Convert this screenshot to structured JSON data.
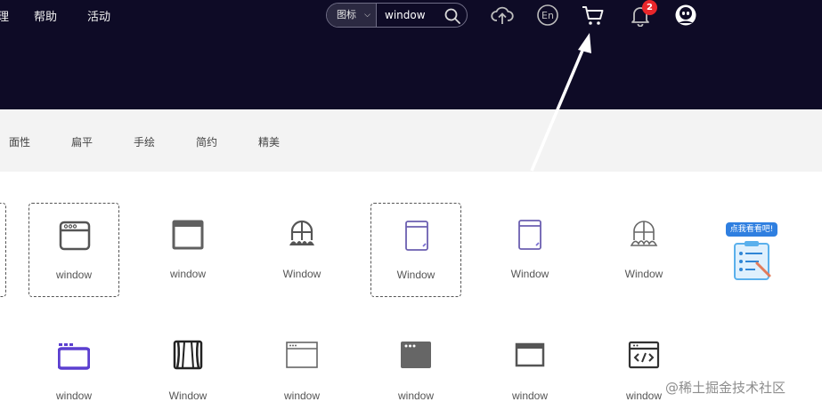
{
  "header": {
    "nav_partial": "理",
    "nav": [
      "帮助",
      "活动"
    ],
    "search": {
      "category": "图标",
      "value": "window"
    },
    "notification_count": "2"
  },
  "filters": [
    "面性",
    "扁平",
    "手绘",
    "简约",
    "精美"
  ],
  "grid": {
    "row1": [
      "window",
      "window",
      "Window",
      "Window",
      "Window",
      "Window"
    ],
    "promo_label": "点我看看吧!",
    "row2": [
      "window",
      "Window",
      "window",
      "window",
      "window",
      "window"
    ]
  },
  "watermark": "@稀土掘金技术社区",
  "colors": {
    "header_bg": "#0e0b26",
    "filter_bg": "#f3f3f3",
    "badge": "#e8262b",
    "accent_purple": "#5b3fd0"
  }
}
